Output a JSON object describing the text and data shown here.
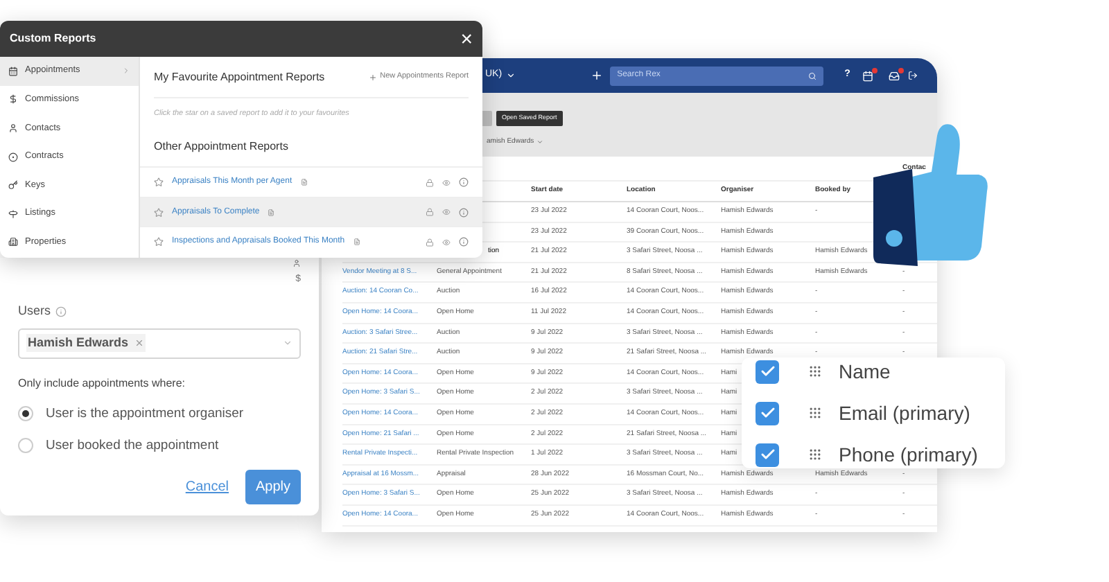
{
  "app_window": {
    "region": "UK)",
    "search": {
      "placeholder": "Search Rex"
    },
    "help": "?",
    "toolbar": {
      "button": "Open Saved Report",
      "user_filter": "amish Edwards"
    },
    "table": {
      "group_header": "Contac",
      "columns": [
        "Start date",
        "Location",
        "Organiser",
        "Booked by"
      ],
      "rows": [
        {
          "start": "23 Jul 2022",
          "location": "14 Cooran Court, Noos...",
          "organiser": "Hamish Edwards",
          "booked_by": "-"
        },
        {
          "start": "23 Jul 2022",
          "location": "39 Cooran Court, Noos...",
          "organiser": "Hamish Edwards"
        },
        {
          "type_fragment": "tion",
          "start": "21 Jul 2022",
          "location": "3 Safari Street, Noosa ...",
          "organiser": "Hamish Edwards",
          "booked_by": "Hamish Edwards"
        },
        {
          "title": "Vendor Meeting at 8 S...",
          "type": "General Appointment",
          "start": "21 Jul 2022",
          "location": "8 Safari Street, Noosa ...",
          "organiser": "Hamish Edwards",
          "booked_by": "Hamish Edwards",
          "contact": "-"
        },
        {
          "title": "Auction: 14 Cooran Co...",
          "type": "Auction",
          "start": "16 Jul 2022",
          "location": "14 Cooran Court, Noos...",
          "organiser": "Hamish Edwards",
          "booked_by": "-",
          "contact": "-"
        },
        {
          "title": "Open Home: 14 Coora...",
          "type": "Open Home",
          "start": "11 Jul 2022",
          "location": "14 Cooran Court, Noos...",
          "organiser": "Hamish Edwards",
          "booked_by": "-",
          "contact": "-"
        },
        {
          "title": "Auction: 3 Safari Stree...",
          "type": "Auction",
          "start": "9 Jul 2022",
          "location": "3 Safari Street, Noosa ...",
          "organiser": "Hamish Edwards",
          "booked_by": "-",
          "contact": "-"
        },
        {
          "title": "Auction: 21 Safari Stre...",
          "type": "Auction",
          "start": "9 Jul 2022",
          "location": "21 Safari Street, Noosa ...",
          "organiser": "Hamish Edwards",
          "booked_by": "-",
          "contact": "-"
        },
        {
          "title": "Open Home: 14 Coora...",
          "type": "Open Home",
          "start": "9 Jul 2022",
          "location": "14 Cooran Court, Noos...",
          "organiser": "Hami"
        },
        {
          "title": "Open Home: 3 Safari S...",
          "type": "Open Home",
          "start": "2 Jul 2022",
          "location": "3 Safari Street, Noosa ...",
          "organiser": "Hami"
        },
        {
          "title": "Open Home: 14 Coora...",
          "type": "Open Home",
          "start": "2 Jul 2022",
          "location": "14 Cooran Court, Noos...",
          "organiser": "Hami"
        },
        {
          "title": "Open Home: 21 Safari ...",
          "type": "Open Home",
          "start": "2 Jul 2022",
          "location": "21 Safari Street, Noosa ...",
          "organiser": "Hami"
        },
        {
          "title": "Rental Private Inspecti...",
          "type": "Rental Private Inspection",
          "start": "1 Jul 2022",
          "location": "3 Safari Street, Noosa ...",
          "organiser": "Hami"
        },
        {
          "title": "Appraisal at 16 Mossm...",
          "type": "Appraisal",
          "start": "28 Jun 2022",
          "location": "16 Mossman Court, No...",
          "organiser": "Hamish Edwards",
          "booked_by": "Hamish Edwards",
          "contact": "-"
        },
        {
          "title": "Open Home: 3 Safari S...",
          "type": "Open Home",
          "start": "25 Jun 2022",
          "location": "3 Safari Street, Noosa ...",
          "organiser": "Hamish Edwards",
          "booked_by": "-",
          "contact": "-"
        },
        {
          "title": "Open Home: 14 Coora...",
          "type": "Open Home",
          "start": "25 Jun 2022",
          "location": "14 Cooran Court, Noos...",
          "organiser": "Hamish Edwards",
          "booked_by": "-",
          "contact": "-"
        }
      ]
    }
  },
  "report_dialog": {
    "title": "Custom Reports",
    "close": "×",
    "nav": [
      {
        "label": "Appointments",
        "selected": true
      },
      {
        "label": "Commissions",
        "selected": false
      },
      {
        "label": "Contacts",
        "selected": false
      },
      {
        "label": "Contracts",
        "selected": false
      },
      {
        "label": "Keys",
        "selected": false
      },
      {
        "label": "Listings",
        "selected": false
      },
      {
        "label": "Properties",
        "selected": false
      }
    ],
    "favourites": {
      "heading": "My Favourite Appointment Reports",
      "new_button": "New Appointments Report",
      "hint": "Click the star on a saved report to add it to your favourites"
    },
    "other": {
      "heading": "Other Appointment Reports",
      "reports": [
        {
          "name": "Appraisals This Month per Agent",
          "highlighted": false
        },
        {
          "name": "Appraisals To Complete",
          "highlighted": true
        },
        {
          "name": "Inspections and Appraisals Booked This Month",
          "highlighted": false
        }
      ]
    }
  },
  "filter_panel": {
    "dollar": "$",
    "users_label": "Users",
    "chips": [
      "Hamish Edwards"
    ],
    "condition_label": "Only include appointments where:",
    "options": [
      {
        "label": "User is the appointment organiser",
        "selected": true
      },
      {
        "label": "User booked the appointment",
        "selected": false
      }
    ],
    "cancel": "Cancel",
    "apply": "Apply"
  },
  "column_picker": [
    {
      "label": "Name",
      "checked": true
    },
    {
      "label": "Email (primary)",
      "checked": true
    },
    {
      "label": "Phone (primary)",
      "checked": true
    }
  ]
}
